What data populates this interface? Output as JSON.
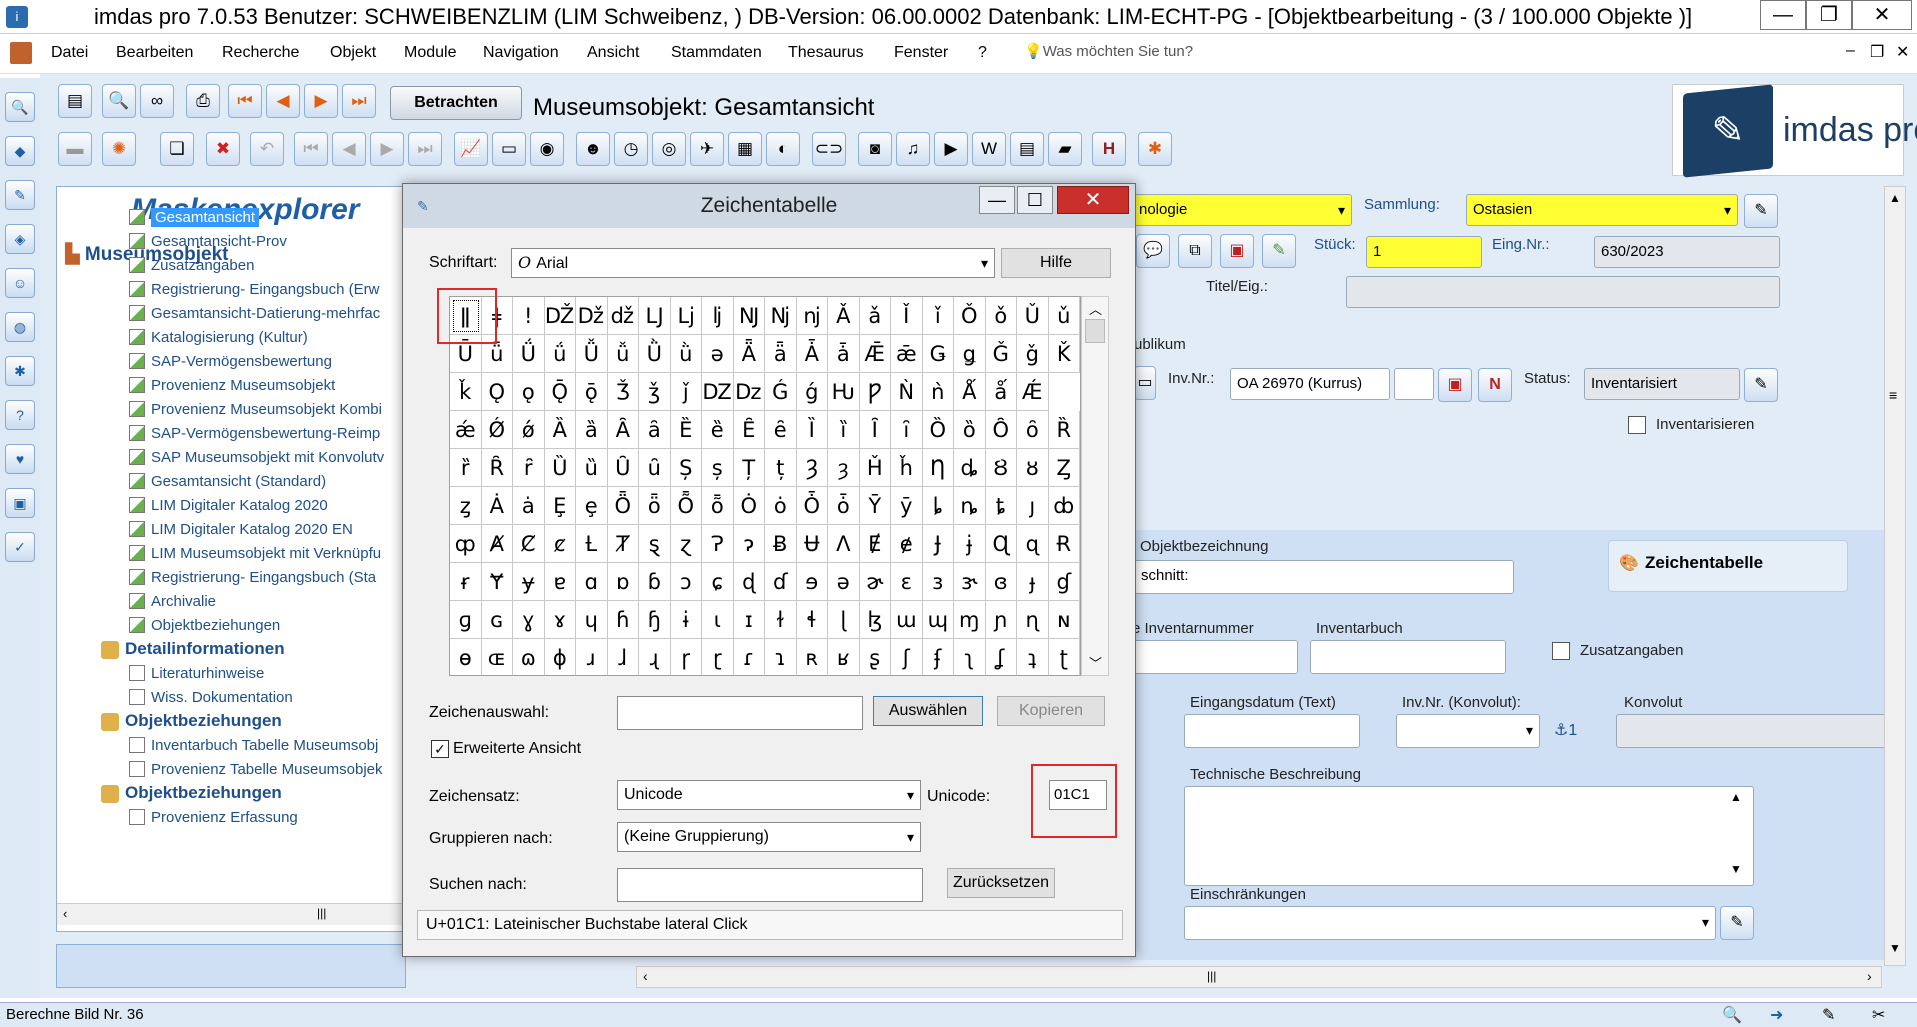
{
  "window": {
    "title": "imdas pro 7.0.53 Benutzer: SCHWEIBENZLIM (LIM Schweibenz, )   DB-Version: 06.00.0002   Datenbank: LIM-ECHT-PG - [Objektbearbeitung - (3 / 100.000 Objekte )]",
    "minimize": "—",
    "restore": "❐",
    "close": "✕"
  },
  "menu": {
    "items": [
      "Datei",
      "Bearbeiten",
      "Recherche",
      "Objekt",
      "Module",
      "Navigation",
      "Ansicht",
      "Stammdaten",
      "Thesaurus",
      "Fenster",
      "?"
    ],
    "help_placeholder": "Was möchten Sie tun?",
    "mdi_min": "–",
    "mdi_restore": "❐",
    "mdi_close": "✕"
  },
  "toolbar": {
    "betrachten_label": "Betrachten",
    "page_title": "Museumsobjekt: Gesamtansicht",
    "logo_text": "imdas pro"
  },
  "maskenexplorer": {
    "title": "Maskenexplorer",
    "root": "Museumsobjekt",
    "items": [
      "Gesamtansicht",
      "Gesamtansicht-Prov",
      "Zusatzangaben",
      "Registrierung- Eingangsbuch (Erw",
      "Gesamtansicht-Datierung-mehrfac",
      "Katalogisierung (Kultur)",
      "SAP-Vermögensbewertung",
      "Provenienz Museumsobjekt",
      "Provenienz Museumsobjekt Kombi",
      "SAP-Vermögensbewertung-Reimp",
      "SAP Museumsobjekt mit Konvolutv",
      "Gesamtansicht (Standard)",
      "LIM Digitaler Katalog 2020",
      "LIM Digitaler Katalog 2020 EN",
      "LIM Museumsobjekt mit Verknüpfu",
      "Registrierung- Eingangsbuch (Sta",
      "Archivalie",
      "Objektbeziehungen"
    ],
    "group_detail": "Detailinformationen",
    "detail_items": [
      "Literaturhinweise",
      "Wiss. Dokumentation"
    ],
    "group_obj1": "Objektbeziehungen",
    "obj1_items": [
      "Inventarbuch Tabelle Museumsobj",
      "Provenienz Tabelle Museumsobjek"
    ],
    "group_obj2": "Objektbeziehungen",
    "obj2_items": [
      "Provenienz Erfassung"
    ]
  },
  "form": {
    "field_top_value": "nologie",
    "sammlung_label": "Sammlung:",
    "sammlung_value": "Ostasien",
    "stueck_label": "Stück:",
    "stueck_value": "1",
    "eingnr_label": "Eing.Nr.:",
    "eingnr_value": "630/2023",
    "titel_label": "Titel/Eig.:",
    "publikum_label": "ublikum",
    "invnr_label": "Inv.Nr.:",
    "invnr_value": "OA 26970 (Kurrus)",
    "n_button": "N",
    "status_label": "Status:",
    "status_value": "Inventarisiert",
    "inventarisieren_label": "Inventarisieren",
    "objektbezeichnung_label": "Objektbezeichnung",
    "objektbezeichnung_value": "schnitt:",
    "zeichentabelle_label": "Zeichentabelle",
    "inventarnummer_label": "e Inventarnummer",
    "inventarbuch_label": "Inventarbuch",
    "zusatzangaben_label": "Zusatzangaben",
    "eingangsdatum_label": "Eingangsdatum (Text)",
    "invnr_konvolut_label": "Inv.Nr. (Konvolut):",
    "konvolut_label": "Konvolut",
    "konvolut_count": "1",
    "techn_label": "Technische Beschreibung",
    "einschraenkungen_label": "Einschränkungen"
  },
  "dialog": {
    "title": "Zeichentabelle",
    "schriftart_label": "Schriftart:",
    "schriftart_value": "Arial",
    "hilfe": "Hilfe",
    "rows": [
      [
        "ǁ",
        "ǂ",
        "ǃ",
        "Ǆ",
        "ǅ",
        "ǆ",
        "Ǉ",
        "ǈ",
        "ǉ",
        "Ǌ",
        "ǋ",
        "ǌ",
        "Ǎ",
        "ǎ",
        "Ǐ",
        "ǐ",
        "Ǒ",
        "ǒ",
        "Ǔ",
        "ǔ"
      ],
      [
        "Ǖ",
        "ǖ",
        "Ǘ",
        "ǘ",
        "Ǚ",
        "ǚ",
        "Ǜ",
        "ǜ",
        "ǝ",
        "Ǟ",
        "ǟ",
        "Ǡ",
        "ǡ",
        "Ǣ",
        "ǣ",
        "Ǥ",
        "ǥ",
        "Ǧ",
        "ǧ",
        "Ǩ"
      ],
      [
        "ǩ",
        "Ǫ",
        "ǫ",
        "Ǭ",
        "ǭ",
        "Ǯ",
        "ǯ",
        "ǰ",
        "Ǳ",
        "ǲ",
        "Ǵ",
        "ǵ",
        "Ƕ",
        "Ƿ",
        "Ǹ",
        "ǹ",
        "Ǻ",
        "ǻ",
        "Ǽ"
      ],
      [
        "ǽ",
        "Ǿ",
        "ǿ",
        "Ȁ",
        "ȁ",
        "Ȃ",
        "ȃ",
        "Ȅ",
        "ȅ",
        "Ȇ",
        "ȇ",
        "Ȉ",
        "ȉ",
        "Ȋ",
        "ȋ",
        "Ȍ",
        "ȍ",
        "Ȏ",
        "ȏ",
        "Ȑ"
      ],
      [
        "ȑ",
        "Ȓ",
        "ȓ",
        "Ȕ",
        "ȕ",
        "Ȗ",
        "ȗ",
        "Ș",
        "ș",
        "Ț",
        "ț",
        "Ȝ",
        "ȝ",
        "Ȟ",
        "ȟ",
        "Ƞ",
        "ȡ",
        "Ȣ",
        "ȣ",
        "Ȥ"
      ],
      [
        "ȥ",
        "Ȧ",
        "ȧ",
        "Ȩ",
        "ȩ",
        "Ȫ",
        "ȫ",
        "Ȭ",
        "ȭ",
        "Ȯ",
        "ȯ",
        "Ȱ",
        "ȱ",
        "Ȳ",
        "ȳ",
        "ȴ",
        "ȵ",
        "ȶ",
        "ȷ",
        "ȸ"
      ],
      [
        "ȹ",
        "Ⱥ",
        "Ȼ",
        "ȼ",
        "Ƚ",
        "Ⱦ",
        "ȿ",
        "ɀ",
        "Ɂ",
        "ɂ",
        "Ƀ",
        "Ʉ",
        "Ʌ",
        "Ɇ",
        "ɇ",
        "Ɉ",
        "ɉ",
        "Ɋ",
        "ɋ",
        "Ɍ"
      ],
      [
        "ɍ",
        "Ɏ",
        "ɏ",
        "ɐ",
        "ɑ",
        "ɒ",
        "ɓ",
        "ɔ",
        "ɕ",
        "ɖ",
        "ɗ",
        "ɘ",
        "ə",
        "ɚ",
        "ɛ",
        "ɜ",
        "ɝ",
        "ɞ",
        "ɟ",
        "ɠ"
      ],
      [
        "ɡ",
        "ɢ",
        "ɣ",
        "ɤ",
        "ɥ",
        "ɦ",
        "ɧ",
        "ɨ",
        "ɩ",
        "ɪ",
        "ɫ",
        "ɬ",
        "ɭ",
        "ɮ",
        "ɯ",
        "ɰ",
        "ɱ",
        "ɲ",
        "ɳ",
        "ɴ"
      ],
      [
        "ɵ",
        "ɶ",
        "ɷ",
        "ɸ",
        "ɹ",
        "ɺ",
        "ɻ",
        "ɼ",
        "ɽ",
        "ɾ",
        "ɿ",
        "ʀ",
        "ʁ",
        "ʂ",
        "ʃ",
        "ʄ",
        "ʅ",
        "ʆ",
        "ʇ",
        "ʈ"
      ]
    ],
    "zeichenauswahl_label": "Zeichenauswahl:",
    "zeichenauswahl_value": "",
    "auswaehlen": "Auswählen",
    "kopieren": "Kopieren",
    "erweiterte_label": "Erweiterte Ansicht",
    "zeichensatz_label": "Zeichensatz:",
    "zeichensatz_value": "Unicode",
    "unicode_label": "Unicode:",
    "unicode_value": "01C1",
    "gruppieren_label": "Gruppieren nach:",
    "gruppieren_value": "(Keine Gruppierung)",
    "suchen_label": "Suchen nach:",
    "suchen_value": "",
    "zuruecksetzen": "Zurücksetzen",
    "status": "U+01C1: Lateinischer Buchstabe lateral Click"
  },
  "statusbar": {
    "text": "Berechne Bild Nr. 36"
  }
}
